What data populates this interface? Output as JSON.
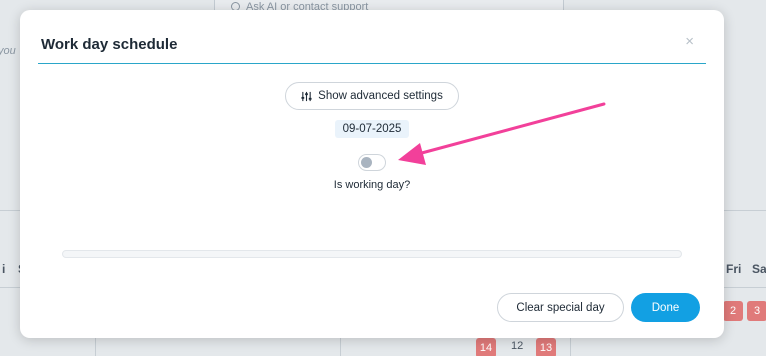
{
  "background": {
    "search_placeholder": "Ask AI or contact support",
    "side_text": "you",
    "left_day_head": "i",
    "left_day_head2": "S",
    "right_day_heads": [
      "Fri",
      "Sa"
    ],
    "right_red_days": [
      "2",
      "3"
    ],
    "bottom_nums": [
      "14",
      "12",
      "13"
    ]
  },
  "modal": {
    "title": "Work day schedule",
    "close_symbol": "×",
    "advanced_label": "Show advanced settings",
    "date": "09-07-2025",
    "working_day_label": "Is working day?",
    "working_day_on": false,
    "progress_fraction": 0,
    "clear_label": "Clear special day",
    "done_label": "Done"
  },
  "colors": {
    "accent": "#12a0e3",
    "header_rule": "#2aa6c9",
    "annotation_arrow": "#f2409a",
    "weekend_red": "#e07a7a"
  },
  "icons": [
    "search-icon",
    "close-icon",
    "sliders-icon",
    "arrow-annotation-icon"
  ]
}
